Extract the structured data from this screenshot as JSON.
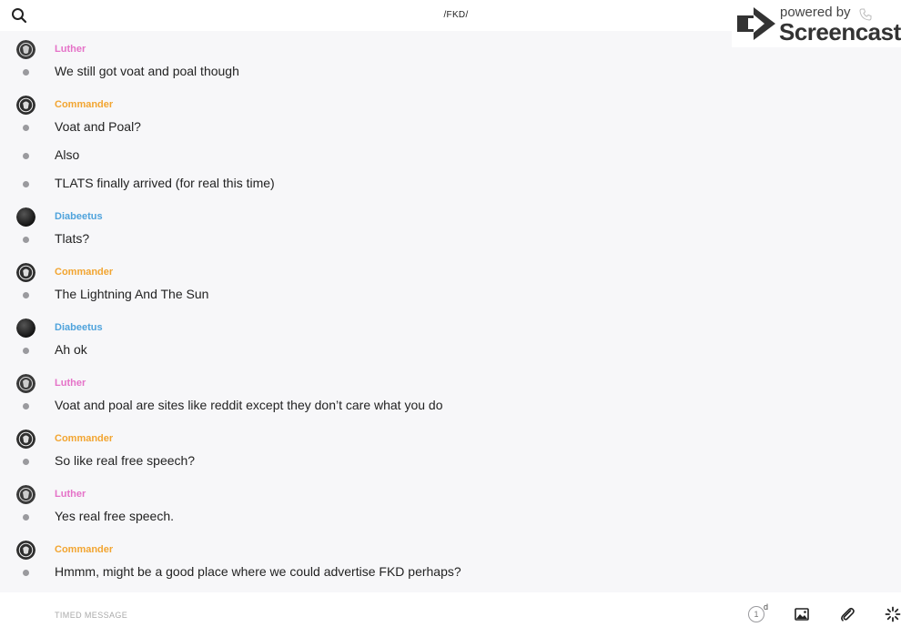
{
  "header": {
    "title": "/FKD/"
  },
  "watermark": {
    "powered": "powered by",
    "brand": "Screencastify"
  },
  "colors": {
    "luther": "#e572c8",
    "commander": "#f2a531",
    "diabeetus": "#4fa3dc"
  },
  "messages": [
    {
      "sender": "Luther",
      "lines": [
        "We still got voat and poal though"
      ]
    },
    {
      "sender": "Commander",
      "lines": [
        "Voat and Poal?",
        "Also",
        "TLATS finally arrived (for real this time)"
      ]
    },
    {
      "sender": "Diabeetus",
      "lines": [
        "Tlats?"
      ]
    },
    {
      "sender": "Commander",
      "lines": [
        "The Lightning And The Sun"
      ]
    },
    {
      "sender": "Diabeetus",
      "lines": [
        "Ah ok"
      ]
    },
    {
      "sender": "Luther",
      "lines": [
        "Voat and poal are sites like reddit except they don’t care what you do"
      ]
    },
    {
      "sender": "Commander",
      "lines": [
        "So like real free speech?"
      ]
    },
    {
      "sender": "Luther",
      "lines": [
        "Yes real free speech."
      ]
    },
    {
      "sender": "Commander",
      "lines": [
        "Hmmm, might be a good place where we could advertise FKD perhaps?"
      ]
    }
  ],
  "composer": {
    "placeholder": "TIMED MESSAGE",
    "timer_value": "1",
    "timer_unit": "d",
    "icons": [
      "image-icon",
      "paperclip-icon",
      "loading-spinner-icon"
    ]
  }
}
